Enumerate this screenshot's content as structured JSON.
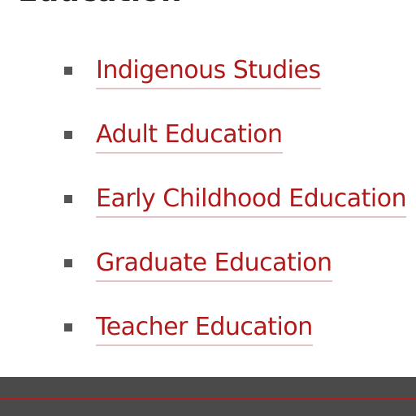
{
  "section": {
    "heading": "Education"
  },
  "links": [
    {
      "label": "Indigenous Studies"
    },
    {
      "label": "Adult Education"
    },
    {
      "label": "Early Childhood Education"
    },
    {
      "label": "Graduate Education"
    },
    {
      "label": "Teacher Education"
    }
  ],
  "colors": {
    "link": "#b01a1a",
    "bullet": "#555555",
    "footer": "#4a4a4a",
    "footer_accent": "#b01a1a"
  }
}
